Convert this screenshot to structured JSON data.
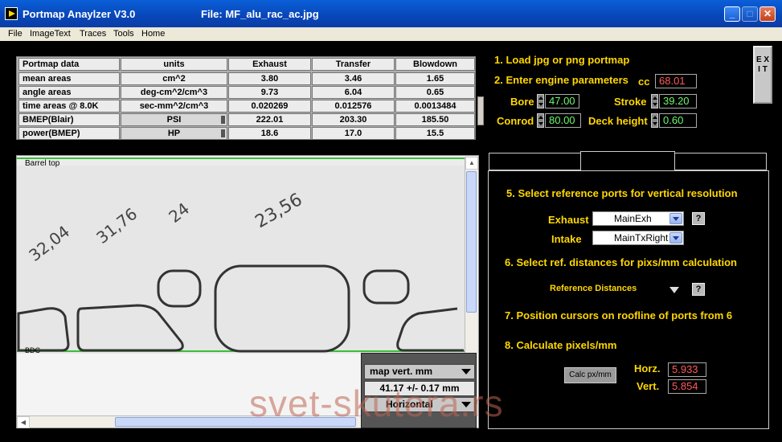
{
  "window": {
    "title": "Portmap Anaylzer V3.0",
    "file_label": "File: MF_alu_rac_ac.jpg",
    "minimize": "_",
    "maximize": "□",
    "close": "✕"
  },
  "menu": [
    "File",
    "ImageText",
    "Traces",
    "Tools",
    "Home"
  ],
  "table": {
    "headers": [
      "Portmap data",
      "units",
      "Exhaust",
      "Transfer",
      "Blowdown"
    ],
    "rows": [
      [
        "mean areas",
        "cm^2",
        "3.80",
        "3.46",
        "1.65"
      ],
      [
        "angle areas",
        "deg-cm^2/cm^3",
        "9.73",
        "6.04",
        "0.65"
      ],
      [
        "time areas @ 8.0K",
        "sec-mm^2/cm^3",
        "0.020269",
        "0.012576",
        "0.0013484"
      ],
      [
        "BMEP(Blair)",
        "PSI",
        "222.01",
        "203.30",
        "185.50"
      ],
      [
        "power(BMEP)",
        "HP",
        "18.6",
        "17.0",
        "15.5"
      ]
    ]
  },
  "image": {
    "top_label": "Barrel top",
    "bottom_label": "BDC",
    "handwritten": [
      "32,04",
      "31,76",
      "24",
      "23,56"
    ]
  },
  "map": {
    "mode": "map vert. mm",
    "value": "41.17 +/- 0.17 mm",
    "orientation": "Horizontal"
  },
  "steps": {
    "s1": "1. Load jpg or png portmap",
    "s2": "2. Enter engine parameters",
    "s5": "5. Select reference ports for vertical resolution",
    "s6": "6. Select ref. distances for pixs/mm calculation",
    "s7": "7. Position cursors on roofline of ports from 6",
    "s8": "8. Calculate pixels/mm"
  },
  "params": {
    "cc_label": "cc",
    "cc": "68.01",
    "bore_label": "Bore",
    "bore": "47.00",
    "stroke_label": "Stroke",
    "stroke": "39.20",
    "conrod_label": "Conrod",
    "conrod": "80.00",
    "deck_label": "Deck height",
    "deck": "0.60"
  },
  "exit_label": "E X I T",
  "refs": {
    "exhaust_label": "Exhaust",
    "exhaust": "MainExh",
    "intake_label": "Intake",
    "intake": "MainTxRight",
    "help": "?",
    "ref_distances": "Reference Distances"
  },
  "calc": {
    "button": "Calc px/mm",
    "horz_label": "Horz.",
    "horz": "5.933",
    "vert_label": "Vert.",
    "vert": "5.854"
  },
  "watermark": "svet-skutera.rs",
  "colors": {
    "accent": "#ffd700",
    "red_value": "#ff5a5a",
    "green_value": "#6ef86e"
  }
}
